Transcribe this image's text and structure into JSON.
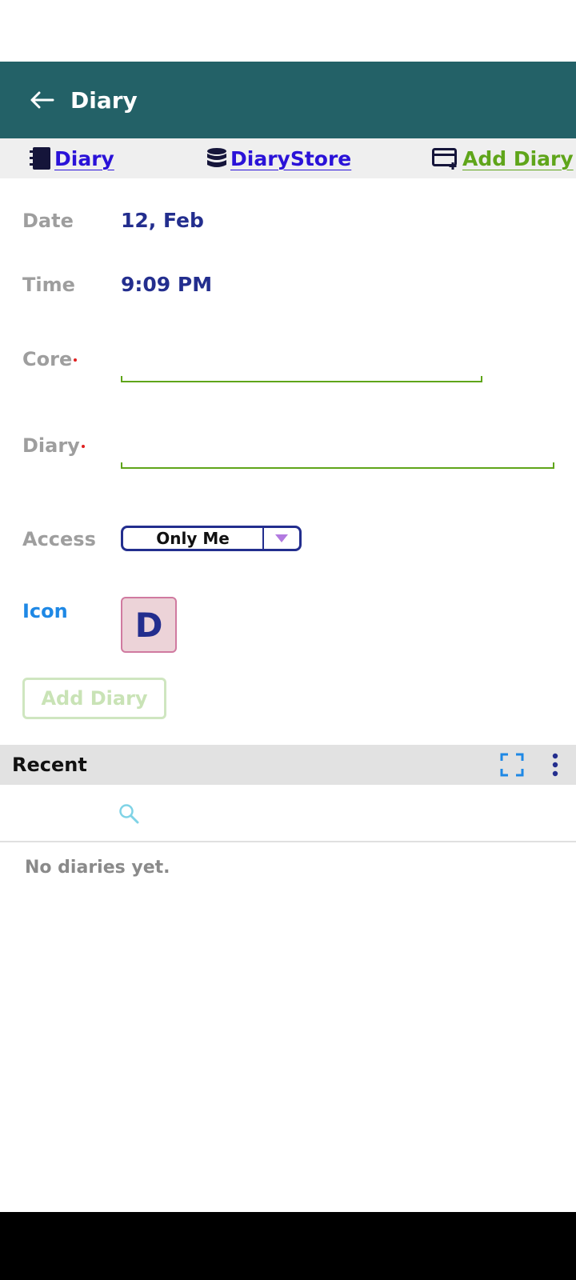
{
  "app_bar": {
    "title": "Diary"
  },
  "tabs": [
    {
      "label": "Diary"
    },
    {
      "label": "DiaryStore"
    },
    {
      "label": "Add Diary"
    }
  ],
  "form": {
    "date_label": "Date",
    "date_value": "12, Feb",
    "time_label": "Time",
    "time_value": "9:09 PM",
    "core_label": "Core",
    "core_value": "",
    "diary_label": "Diary",
    "diary_value": "",
    "access_label": "Access",
    "access_value": "Only Me",
    "icon_label": "Icon",
    "icon_letter": "D",
    "submit_label": "Add Diary"
  },
  "recent": {
    "title": "Recent",
    "search_placeholder": "",
    "empty_message": "No diaries yet."
  },
  "colors": {
    "app_bar": "#236167",
    "tab_link": "#2a12d8",
    "tab_add": "#5fa51a",
    "value_text": "#232e8e",
    "icon_label": "#1e88e5"
  }
}
